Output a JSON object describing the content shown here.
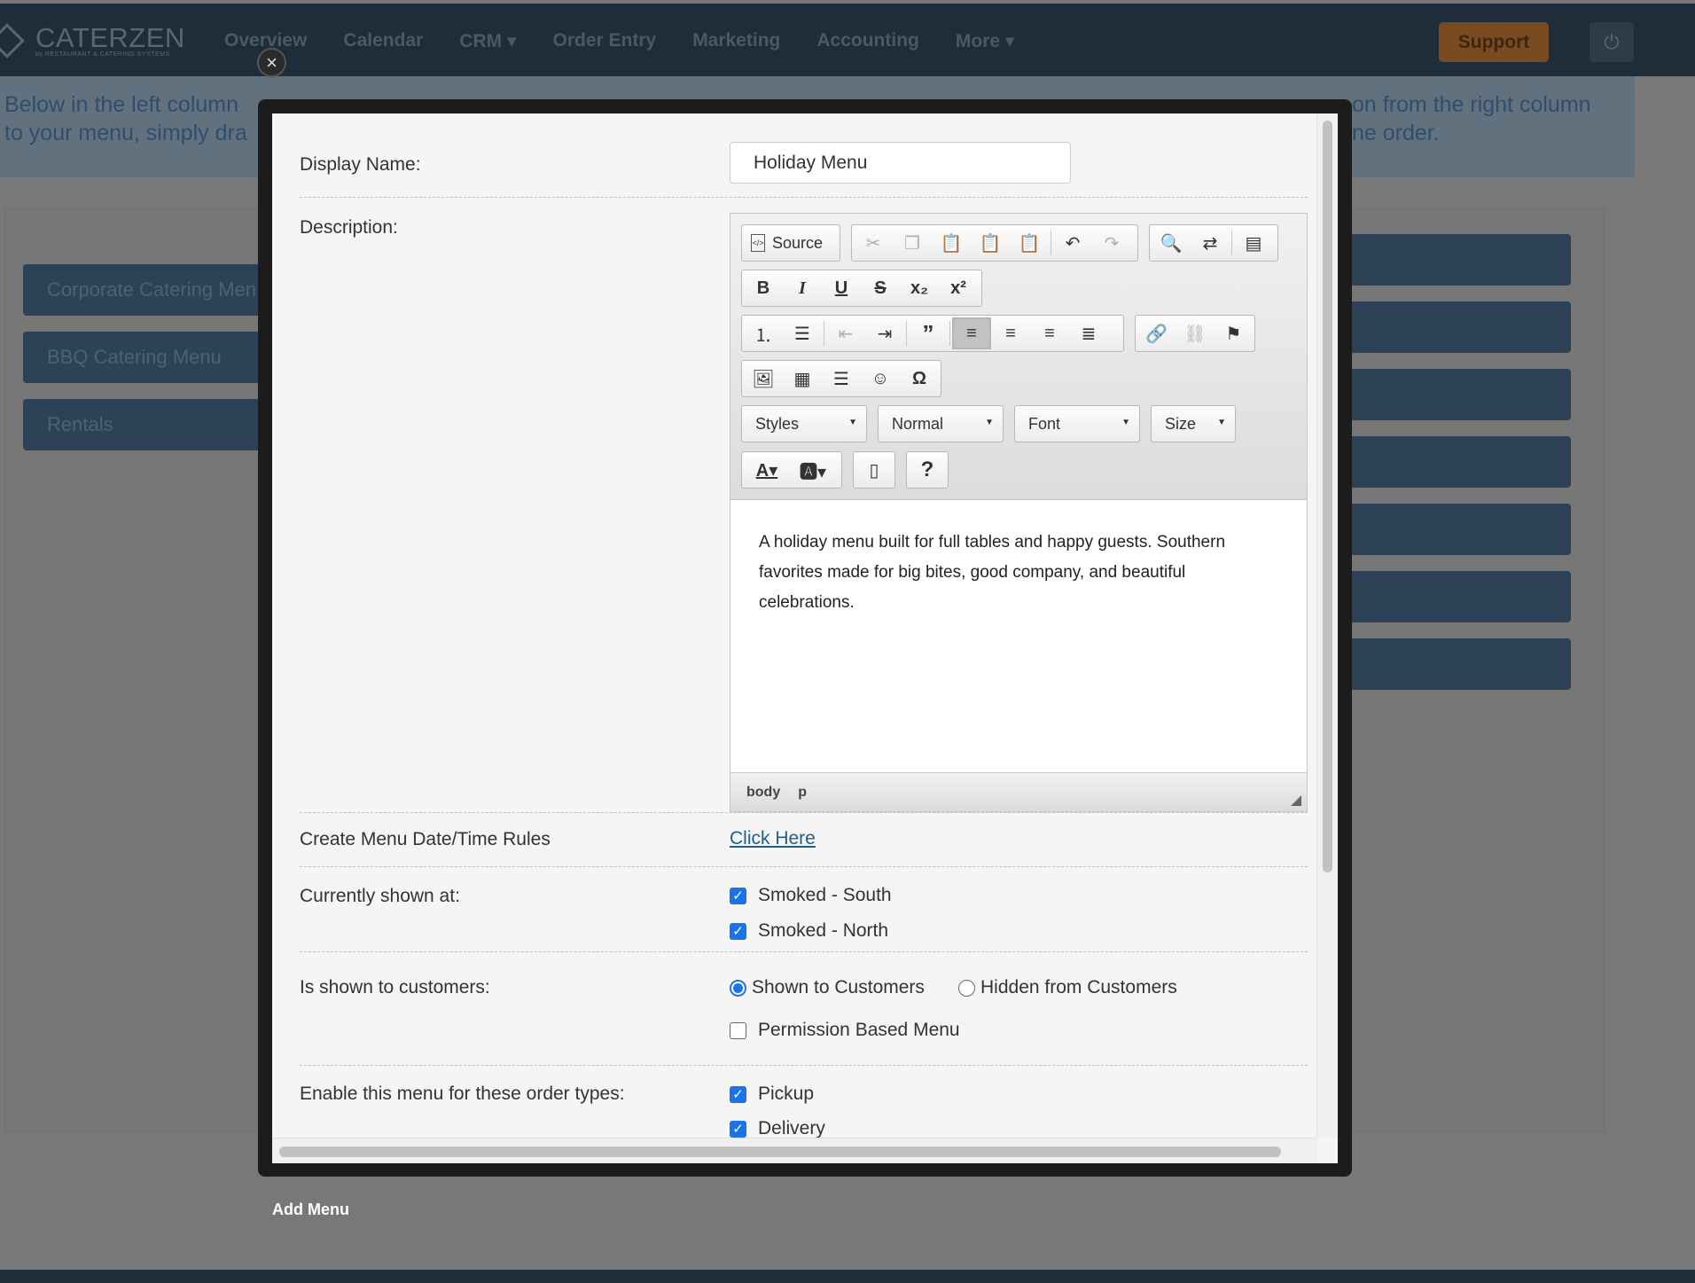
{
  "app": {
    "logo_name": "CATERZEN",
    "logo_sub": "by RESTAURANT & CATERING SYSTEMS"
  },
  "nav": {
    "items": [
      "Overview",
      "Calendar",
      "CRM ▾",
      "Order Entry",
      "Marketing",
      "Accounting",
      "More ▾"
    ],
    "support_label": "Support"
  },
  "info": {
    "line1_left": "Below in the left column",
    "line1_right": "on from the right column",
    "line2_left": "to your menu, simply dra",
    "line2_right": "ne order."
  },
  "menus": {
    "left": [
      "Corporate Catering Men",
      "BBQ Catering Menu",
      "Rentals"
    ]
  },
  "add_menu_label": "Add Menu",
  "modal": {
    "display_name_label": "Display Name:",
    "display_name_value": "Holiday Menu",
    "description_label": "Description:",
    "editor": {
      "source_label": "Source",
      "styles_label": "Styles",
      "format_label": "Normal",
      "font_label": "Font",
      "size_label": "Size",
      "content": "A holiday menu built for full tables and happy guests. Southern favorites made for big bites, good company, and beautiful celebrations.",
      "path_body": "body",
      "path_p": "p"
    },
    "rules_label": "Create Menu Date/Time Rules",
    "rules_link": "Click Here",
    "shown_at_label": "Currently shown at:",
    "locations": [
      "Smoked - South",
      "Smoked - North"
    ],
    "customers_label": "Is shown to customers:",
    "shown_option": "Shown to Customers",
    "hidden_option": "Hidden from Customers",
    "permission_label": "Permission Based Menu",
    "order_types_label": "Enable this menu for these order types:",
    "order_types": [
      "Pickup",
      "Delivery"
    ]
  }
}
